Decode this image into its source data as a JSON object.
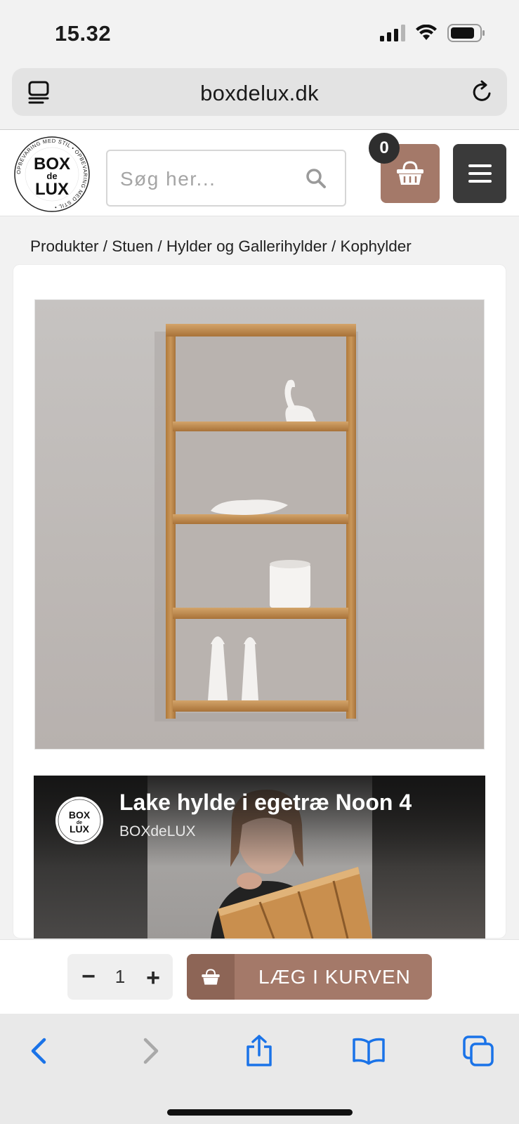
{
  "status_bar": {
    "time": "15.32"
  },
  "browser": {
    "url": "boxdelux.dk"
  },
  "header": {
    "logo_text_top": "BOX",
    "logo_text_mid": "de",
    "logo_text_bottom": "LUX",
    "logo_ring_text": "OPBEVARING MED STIL • OPBEVARING MED STIL •",
    "search_placeholder": "Søg her...",
    "cart_count": "0"
  },
  "breadcrumb": "Produkter / Stuen / Hylder og Gallerihylder / Kophylder",
  "video": {
    "title": "Lake hylde i egetræ Noon 4",
    "channel": "BOXdeLUX"
  },
  "purchase": {
    "quantity": "1",
    "minus_label": "−",
    "plus_label": "+",
    "add_to_cart_label": "LÆG I KURVEN"
  },
  "colors": {
    "accent": "#a47969",
    "accent_dark": "#8d6556",
    "menu_bg": "#3a3a3a",
    "ios_blue": "#1a73e8"
  },
  "icons": {
    "reader": "reader-icon",
    "reload": "reload-icon",
    "search": "search-icon",
    "cart": "basket-icon",
    "menu": "hamburger-icon",
    "back": "chevron-left-icon",
    "forward": "chevron-right-icon",
    "share": "share-icon",
    "bookmarks": "book-icon",
    "tabs": "tabs-icon"
  }
}
